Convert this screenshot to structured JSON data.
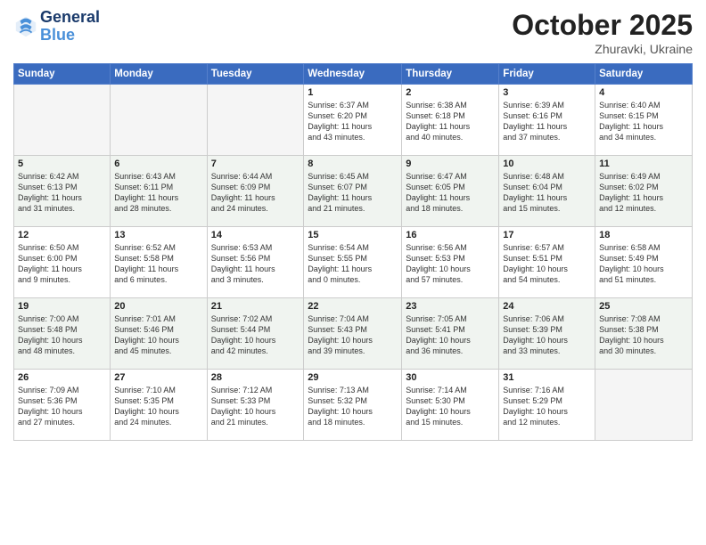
{
  "header": {
    "logo_line1": "General",
    "logo_line2": "Blue",
    "month": "October 2025",
    "location": "Zhuravki, Ukraine"
  },
  "days_of_week": [
    "Sunday",
    "Monday",
    "Tuesday",
    "Wednesday",
    "Thursday",
    "Friday",
    "Saturday"
  ],
  "weeks": [
    [
      {
        "day": "",
        "info": ""
      },
      {
        "day": "",
        "info": ""
      },
      {
        "day": "",
        "info": ""
      },
      {
        "day": "1",
        "info": "Sunrise: 6:37 AM\nSunset: 6:20 PM\nDaylight: 11 hours\nand 43 minutes."
      },
      {
        "day": "2",
        "info": "Sunrise: 6:38 AM\nSunset: 6:18 PM\nDaylight: 11 hours\nand 40 minutes."
      },
      {
        "day": "3",
        "info": "Sunrise: 6:39 AM\nSunset: 6:16 PM\nDaylight: 11 hours\nand 37 minutes."
      },
      {
        "day": "4",
        "info": "Sunrise: 6:40 AM\nSunset: 6:15 PM\nDaylight: 11 hours\nand 34 minutes."
      }
    ],
    [
      {
        "day": "5",
        "info": "Sunrise: 6:42 AM\nSunset: 6:13 PM\nDaylight: 11 hours\nand 31 minutes."
      },
      {
        "day": "6",
        "info": "Sunrise: 6:43 AM\nSunset: 6:11 PM\nDaylight: 11 hours\nand 28 minutes."
      },
      {
        "day": "7",
        "info": "Sunrise: 6:44 AM\nSunset: 6:09 PM\nDaylight: 11 hours\nand 24 minutes."
      },
      {
        "day": "8",
        "info": "Sunrise: 6:45 AM\nSunset: 6:07 PM\nDaylight: 11 hours\nand 21 minutes."
      },
      {
        "day": "9",
        "info": "Sunrise: 6:47 AM\nSunset: 6:05 PM\nDaylight: 11 hours\nand 18 minutes."
      },
      {
        "day": "10",
        "info": "Sunrise: 6:48 AM\nSunset: 6:04 PM\nDaylight: 11 hours\nand 15 minutes."
      },
      {
        "day": "11",
        "info": "Sunrise: 6:49 AM\nSunset: 6:02 PM\nDaylight: 11 hours\nand 12 minutes."
      }
    ],
    [
      {
        "day": "12",
        "info": "Sunrise: 6:50 AM\nSunset: 6:00 PM\nDaylight: 11 hours\nand 9 minutes."
      },
      {
        "day": "13",
        "info": "Sunrise: 6:52 AM\nSunset: 5:58 PM\nDaylight: 11 hours\nand 6 minutes."
      },
      {
        "day": "14",
        "info": "Sunrise: 6:53 AM\nSunset: 5:56 PM\nDaylight: 11 hours\nand 3 minutes."
      },
      {
        "day": "15",
        "info": "Sunrise: 6:54 AM\nSunset: 5:55 PM\nDaylight: 11 hours\nand 0 minutes."
      },
      {
        "day": "16",
        "info": "Sunrise: 6:56 AM\nSunset: 5:53 PM\nDaylight: 10 hours\nand 57 minutes."
      },
      {
        "day": "17",
        "info": "Sunrise: 6:57 AM\nSunset: 5:51 PM\nDaylight: 10 hours\nand 54 minutes."
      },
      {
        "day": "18",
        "info": "Sunrise: 6:58 AM\nSunset: 5:49 PM\nDaylight: 10 hours\nand 51 minutes."
      }
    ],
    [
      {
        "day": "19",
        "info": "Sunrise: 7:00 AM\nSunset: 5:48 PM\nDaylight: 10 hours\nand 48 minutes."
      },
      {
        "day": "20",
        "info": "Sunrise: 7:01 AM\nSunset: 5:46 PM\nDaylight: 10 hours\nand 45 minutes."
      },
      {
        "day": "21",
        "info": "Sunrise: 7:02 AM\nSunset: 5:44 PM\nDaylight: 10 hours\nand 42 minutes."
      },
      {
        "day": "22",
        "info": "Sunrise: 7:04 AM\nSunset: 5:43 PM\nDaylight: 10 hours\nand 39 minutes."
      },
      {
        "day": "23",
        "info": "Sunrise: 7:05 AM\nSunset: 5:41 PM\nDaylight: 10 hours\nand 36 minutes."
      },
      {
        "day": "24",
        "info": "Sunrise: 7:06 AM\nSunset: 5:39 PM\nDaylight: 10 hours\nand 33 minutes."
      },
      {
        "day": "25",
        "info": "Sunrise: 7:08 AM\nSunset: 5:38 PM\nDaylight: 10 hours\nand 30 minutes."
      }
    ],
    [
      {
        "day": "26",
        "info": "Sunrise: 7:09 AM\nSunset: 5:36 PM\nDaylight: 10 hours\nand 27 minutes."
      },
      {
        "day": "27",
        "info": "Sunrise: 7:10 AM\nSunset: 5:35 PM\nDaylight: 10 hours\nand 24 minutes."
      },
      {
        "day": "28",
        "info": "Sunrise: 7:12 AM\nSunset: 5:33 PM\nDaylight: 10 hours\nand 21 minutes."
      },
      {
        "day": "29",
        "info": "Sunrise: 7:13 AM\nSunset: 5:32 PM\nDaylight: 10 hours\nand 18 minutes."
      },
      {
        "day": "30",
        "info": "Sunrise: 7:14 AM\nSunset: 5:30 PM\nDaylight: 10 hours\nand 15 minutes."
      },
      {
        "day": "31",
        "info": "Sunrise: 7:16 AM\nSunset: 5:29 PM\nDaylight: 10 hours\nand 12 minutes."
      },
      {
        "day": "",
        "info": ""
      }
    ]
  ]
}
